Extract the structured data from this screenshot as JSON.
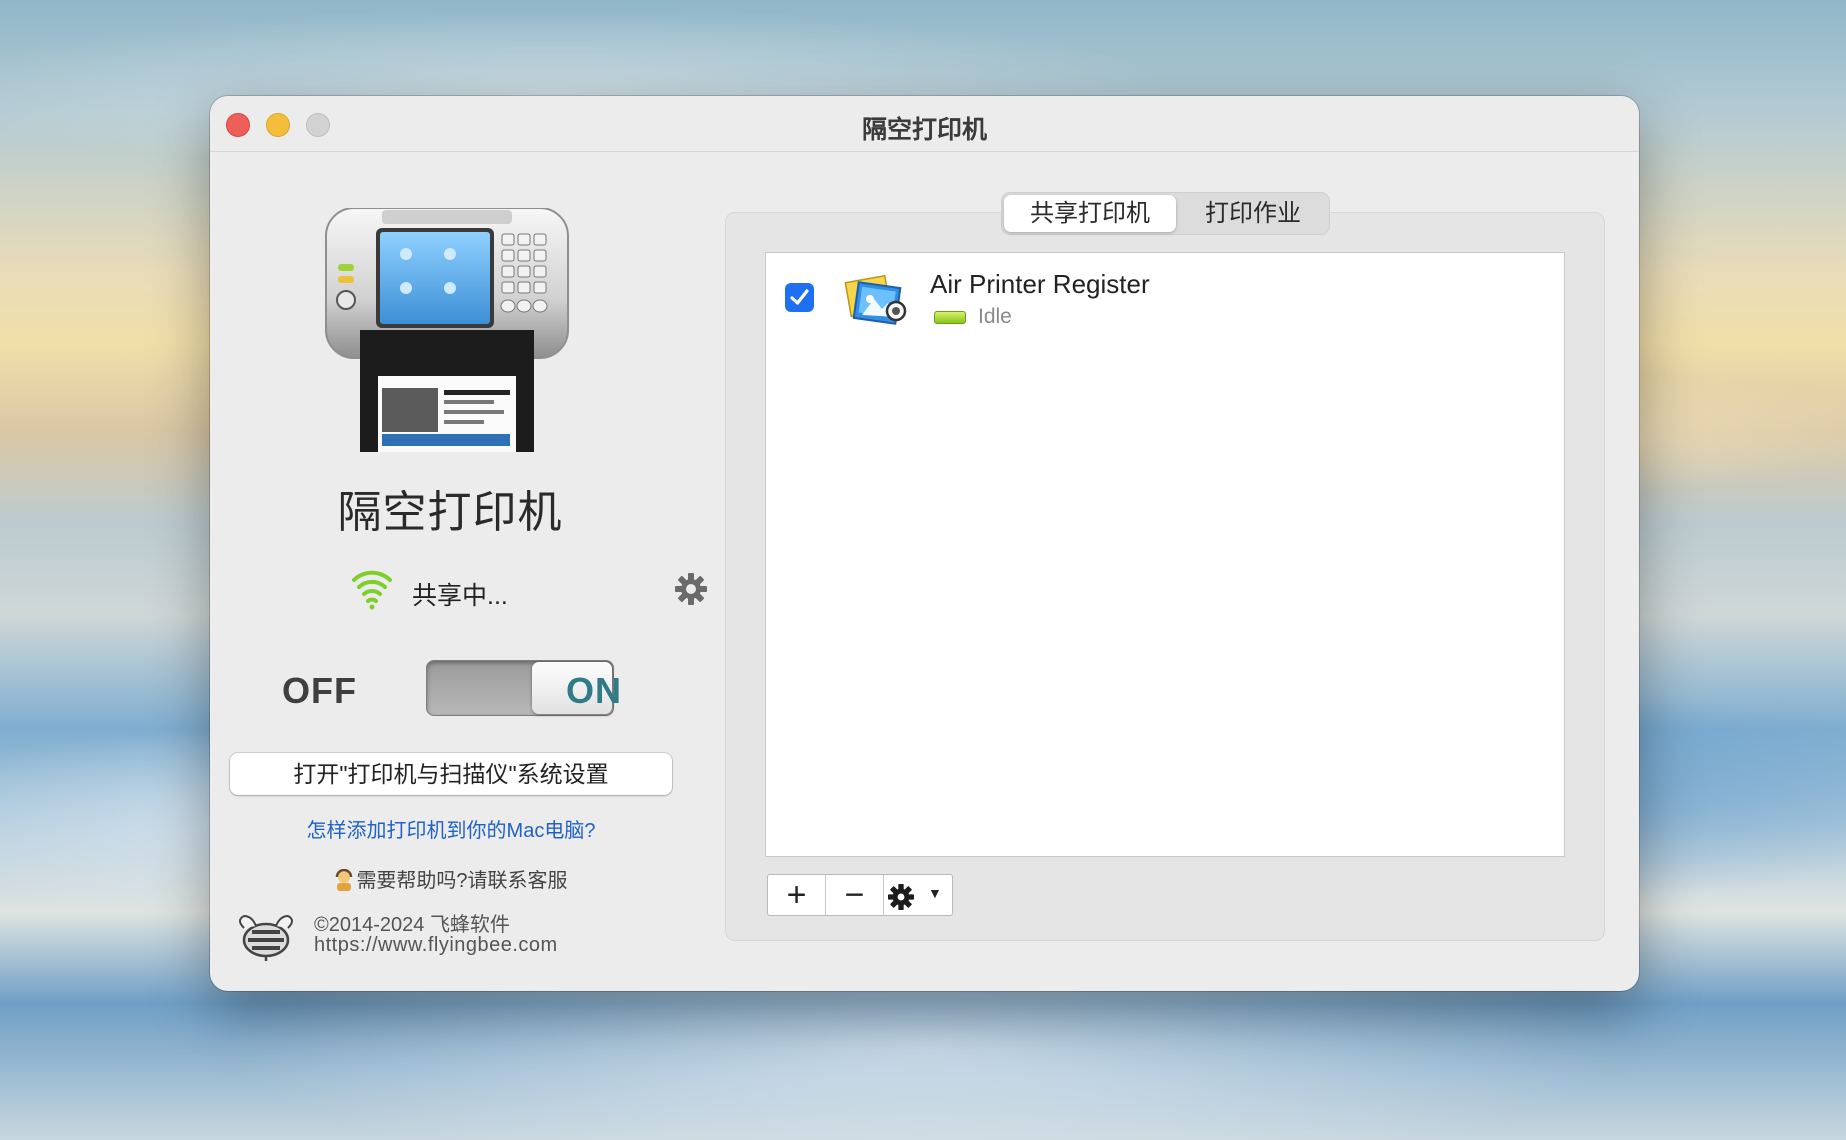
{
  "window": {
    "title": "隔空打印机"
  },
  "sidebar": {
    "app_name": "隔空打印机",
    "status_text": "共享中...",
    "toggle": {
      "off_label": "OFF",
      "on_label": "ON",
      "state": "on"
    },
    "system_settings_button": "打开\"打印机与扫描仪\"系统设置",
    "help_link": "怎样添加打印机到你的Mac电脑?",
    "support_text": "需要帮助吗?请联系客服",
    "copyright": "©2014-2024 飞蜂软件",
    "website": "https://www.flyingbee.com"
  },
  "tabs": [
    {
      "label": "共享打印机",
      "selected": true
    },
    {
      "label": "打印作业",
      "selected": false
    }
  ],
  "printers": [
    {
      "name": "Air Printer Register",
      "status": "Idle",
      "checked": true,
      "status_color": "#88c41d"
    }
  ],
  "toolbar": {
    "add_label": "+",
    "remove_label": "−",
    "action_caret": "▼"
  },
  "colors": {
    "accent_blue": "#1e6ff2",
    "link": "#1f62c7",
    "on_label": "#2f7b86"
  }
}
